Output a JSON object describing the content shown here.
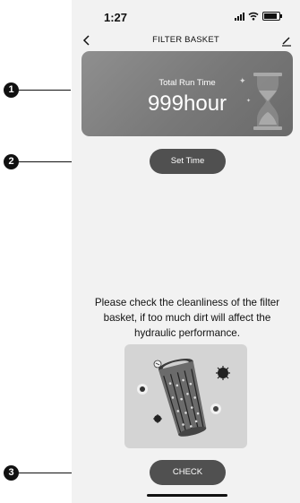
{
  "status_bar": {
    "time": "1:27"
  },
  "header": {
    "title": "FILTER BASKET"
  },
  "run_card": {
    "label": "Total Run Time",
    "value": "999hour"
  },
  "set_time_button": {
    "label": "Set Time"
  },
  "notice": {
    "text": "Please check the cleanliness of the filter basket, if too much dirt will affect the hydraulic performance."
  },
  "check_button": {
    "label": "CHECK"
  },
  "callouts": [
    "1",
    "2",
    "3"
  ],
  "icons": {
    "back": "chevron-left-icon",
    "edit": "pencil-icon",
    "hourglass": "hourglass-icon",
    "illustration": "filter-basket-dirt-illustration"
  },
  "colors": {
    "card": "#7c7c7c",
    "button": "#505050",
    "screen": "#f2f2f2"
  }
}
